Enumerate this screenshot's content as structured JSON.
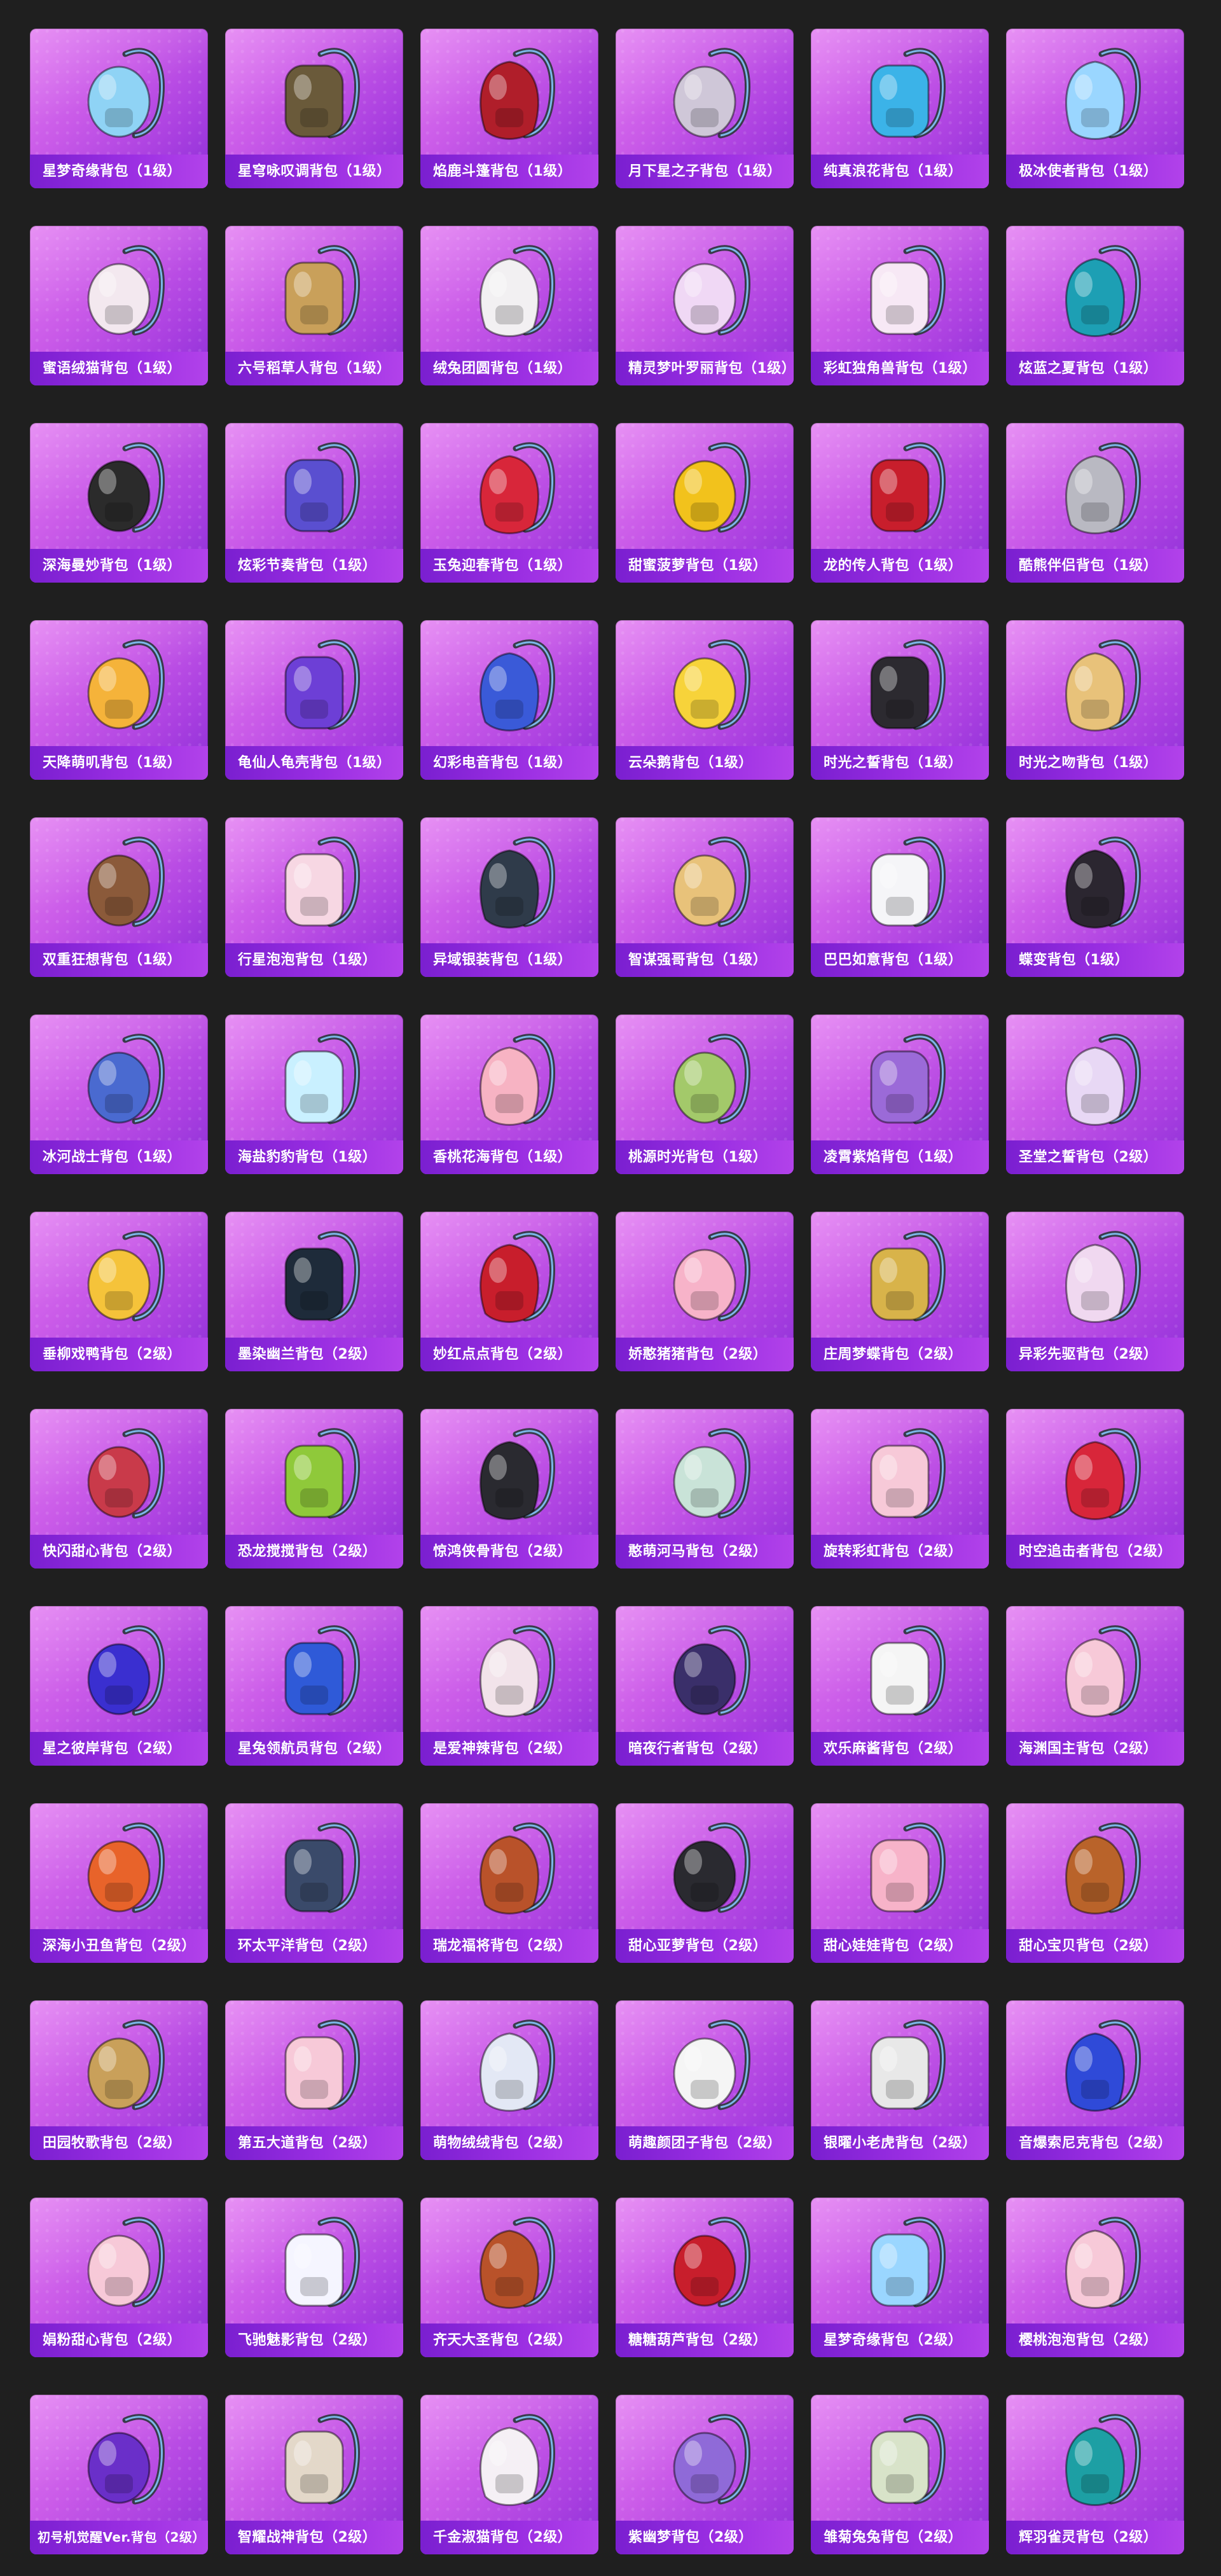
{
  "items": [
    {
      "name": "星梦奇缘背包（1级）",
      "icon": "swan-backpack-icon",
      "color": "#8fd3f5"
    },
    {
      "name": "星穹咏叹调背包（1级）",
      "icon": "bear-backpack-icon",
      "color": "#6a5a3a"
    },
    {
      "name": "焰鹿斗篷背包（1级）",
      "icon": "cloak-backpack-icon",
      "color": "#b01e2a"
    },
    {
      "name": "月下星之子背包（1级）",
      "icon": "orb-backpack-icon",
      "color": "#cfc7d8"
    },
    {
      "name": "纯真浪花背包（1级）",
      "icon": "wave-backpack-icon",
      "color": "#3bb3e8"
    },
    {
      "name": "极冰使者背包（1级）",
      "icon": "ice-backpack-icon",
      "color": "#9ad6ff"
    },
    {
      "name": "蜜语绒猫背包（1级）",
      "icon": "cat-backpack-icon",
      "color": "#f3e8ef"
    },
    {
      "name": "六号稻草人背包（1级）",
      "icon": "scarecrow-backpack-icon",
      "color": "#c9a05a"
    },
    {
      "name": "绒兔团圆背包（1级）",
      "icon": "bunny-backpack-icon",
      "color": "#f2f0f2"
    },
    {
      "name": "精灵梦叶罗丽背包（1级）",
      "icon": "heart-backpack-icon",
      "color": "#f0d8f5"
    },
    {
      "name": "彩虹独角兽背包（1级）",
      "icon": "unicorn-backpack-icon",
      "color": "#f7e8f5"
    },
    {
      "name": "炫蓝之夏背包（1级）",
      "icon": "summer-backpack-icon",
      "color": "#1d9fb4"
    },
    {
      "name": "深海曼妙背包（1级）",
      "icon": "canister-backpack-icon",
      "color": "#2b2b2b"
    },
    {
      "name": "炫彩节奏背包（1级）",
      "icon": "galaxy-backpack-icon",
      "color": "#5a4fd0"
    },
    {
      "name": "玉兔迎春背包（1级）",
      "icon": "red-backpack-icon",
      "color": "#d8263a"
    },
    {
      "name": "甜蜜菠萝背包（1级）",
      "icon": "pineapple-backpack-icon",
      "color": "#f2c21c"
    },
    {
      "name": "龙的传人背包（1级）",
      "icon": "dragon-backpack-icon",
      "color": "#c81e2c"
    },
    {
      "name": "酷熊伴侣背包（1级）",
      "icon": "koala-backpack-icon",
      "color": "#b9b9c2"
    },
    {
      "name": "天降萌叽背包（1级）",
      "icon": "chick-backpack-icon",
      "color": "#f5b33a"
    },
    {
      "name": "龟仙人龟壳背包（1级）",
      "icon": "shell-backpack-icon",
      "color": "#6d3fd6"
    },
    {
      "name": "幻彩电音背包（1级）",
      "icon": "ring-backpack-icon",
      "color": "#3a5ad8"
    },
    {
      "name": "云朵鹅背包（1级）",
      "icon": "flower-backpack-icon",
      "color": "#f7d33a"
    },
    {
      "name": "时光之誓背包（1级）",
      "icon": "clock-backpack-icon",
      "color": "#2c2a30"
    },
    {
      "name": "时光之吻背包（1级）",
      "icon": "pendant-backpack-icon",
      "color": "#e8c27a"
    },
    {
      "name": "双重狂想背包（1级）",
      "icon": "fox-backpack-icon",
      "color": "#8b5a3a"
    },
    {
      "name": "行星泡泡背包（1级）",
      "icon": "rabbit-backpack-icon",
      "color": "#f7d7e3"
    },
    {
      "name": "异域银装背包（1级）",
      "icon": "silver-backpack-icon",
      "color": "#2f3b4a"
    },
    {
      "name": "智谋强哥背包（1级）",
      "icon": "bean-backpack-icon",
      "color": "#e8c27a"
    },
    {
      "name": "巴巴如意背包（1级）",
      "icon": "white-bunny-backpack-icon",
      "color": "#f5f5f8"
    },
    {
      "name": "蝶变背包（1级）",
      "icon": "black-backpack-icon",
      "color": "#2b2630"
    },
    {
      "name": "冰河战士背包（1级）",
      "icon": "armor-backpack-icon",
      "color": "#4a6ad0"
    },
    {
      "name": "海盐豹豹背包（1级）",
      "icon": "seal-backpack-icon",
      "color": "#c9f0ff"
    },
    {
      "name": "香桃花海背包（1级）",
      "icon": "peach-backpack-icon",
      "color": "#f7b3c3"
    },
    {
      "name": "桃源时光背包（1级）",
      "icon": "basket-backpack-icon",
      "color": "#a3c96a"
    },
    {
      "name": "凌霄紫焰背包（1级）",
      "icon": "purple-flame-backpack-icon",
      "color": "#9b6ad8"
    },
    {
      "name": "圣堂之誓背包（2级）",
      "icon": "wing-backpack-icon",
      "color": "#e8d8f5"
    },
    {
      "name": "垂柳戏鸭背包（2级）",
      "icon": "duck-backpack-icon",
      "color": "#f5c33a"
    },
    {
      "name": "墨染幽兰背包（2级）",
      "icon": "orchid-backpack-icon",
      "color": "#1e2b3a"
    },
    {
      "name": "妙红点点背包（2级）",
      "icon": "ladybug-backpack-icon",
      "color": "#c81e2c"
    },
    {
      "name": "娇憨猪猪背包（2级）",
      "icon": "piggy-backpack-icon",
      "color": "#f7b3c9"
    },
    {
      "name": "庄周梦蝶背包（2级）",
      "icon": "butterfly-backpack-icon",
      "color": "#d8b34a"
    },
    {
      "name": "异彩先驱背包（2级）",
      "icon": "robot-backpack-icon",
      "color": "#f0d8f0"
    },
    {
      "name": "快闪甜心背包（2级）",
      "icon": "candy-backpack-icon",
      "color": "#c93a4a"
    },
    {
      "name": "恐龙搅搅背包（2级）",
      "icon": "dino-backpack-icon",
      "color": "#8fc93a"
    },
    {
      "name": "惊鸿侠骨背包（2级）",
      "icon": "tactical-backpack-icon",
      "color": "#2a2a30"
    },
    {
      "name": "憨萌河马背包（2级）",
      "icon": "hippo-backpack-icon",
      "color": "#c9e3d8"
    },
    {
      "name": "旋转彩虹背包（2级）",
      "icon": "dress-backpack-icon",
      "color": "#f7c9d8"
    },
    {
      "name": "时空追击者背包（2级）",
      "icon": "mech-backpack-icon",
      "color": "#d8263a"
    },
    {
      "name": "星之彼岸背包（2级）",
      "icon": "planet-backpack-icon",
      "color": "#3a2fd0"
    },
    {
      "name": "星兔领航员背包（2级）",
      "icon": "astronaut-backpack-icon",
      "color": "#2f5ad8"
    },
    {
      "name": "是爱神辣背包（2级）",
      "icon": "plush-bunny-backpack-icon",
      "color": "#f2e3ea"
    },
    {
      "name": "暗夜行者背包（2级）",
      "icon": "night-backpack-icon",
      "color": "#3a2f6a"
    },
    {
      "name": "欢乐麻酱背包（2级）",
      "icon": "mahjong-backpack-icon",
      "color": "#f5f5f5"
    },
    {
      "name": "海渊国主背包（2级）",
      "icon": "ribbon-backpack-icon",
      "color": "#f7c9d8"
    },
    {
      "name": "深海小丑鱼背包（2级）",
      "icon": "clownfish-backpack-icon",
      "color": "#e8632a"
    },
    {
      "name": "环太平洋背包（2级）",
      "icon": "jaeger-backpack-icon",
      "color": "#3a4a6a"
    },
    {
      "name": "瑞龙福将背包（2级）",
      "icon": "general-backpack-icon",
      "color": "#b9522a"
    },
    {
      "name": "甜心亚萝背包（2级）",
      "icon": "black-cat-backpack-icon",
      "color": "#2a2a30"
    },
    {
      "name": "甜心娃娃背包（2级）",
      "icon": "doll-backpack-icon",
      "color": "#f7b3c9"
    },
    {
      "name": "甜心宝贝背包（2级）",
      "icon": "cake-backpack-icon",
      "color": "#b9632a"
    },
    {
      "name": "田园牧歌背包（2级）",
      "icon": "flower-basket-backpack-icon",
      "color": "#c9a05a"
    },
    {
      "name": "第五大道背包（2级）",
      "icon": "pink-bag-backpack-icon",
      "color": "#f7c9d8"
    },
    {
      "name": "萌物绒绒背包（2级）",
      "icon": "fluffy-backpack-icon",
      "color": "#e3e8f5"
    },
    {
      "name": "萌趣颜团子背包（2级）",
      "icon": "dumpling-backpack-icon",
      "color": "#f5f5f5"
    },
    {
      "name": "银曜小老虎背包（2级）",
      "icon": "tiger-backpack-icon",
      "color": "#e8e8e8"
    },
    {
      "name": "音爆索尼克背包（2级）",
      "icon": "sonic-backpack-icon",
      "color": "#2f4ad8"
    },
    {
      "name": "娟粉甜心背包（2级）",
      "icon": "pink-sweet-backpack-icon",
      "color": "#f7c9d8"
    },
    {
      "name": "飞驰魅影背包（2级）",
      "icon": "cape-backpack-icon",
      "color": "#f5f5ff"
    },
    {
      "name": "齐天大圣背包（2级）",
      "icon": "monkey-king-backpack-icon",
      "color": "#b9522a"
    },
    {
      "name": "糖糖葫芦背包（2级）",
      "icon": "gourd-backpack-icon",
      "color": "#c81e2c"
    },
    {
      "name": "星梦奇缘背包（2级）",
      "icon": "swan-backpack-icon",
      "color": "#9ad6ff"
    },
    {
      "name": "樱桃泡泡背包（2级）",
      "icon": "bow-backpack-icon",
      "color": "#f7c9d8"
    },
    {
      "name": "初号机觉醒Ver.背包（2级）",
      "icon": "eva-backpack-icon",
      "color": "#6a2fc9"
    },
    {
      "name": "智耀战神背包（2级）",
      "icon": "war-god-backpack-icon",
      "color": "#e3d8c9"
    },
    {
      "name": "千金淑猫背包（2级）",
      "icon": "lady-cat-backpack-icon",
      "color": "#f5f0f5"
    },
    {
      "name": "紫幽梦背包（2级）",
      "icon": "violet-backpack-icon",
      "color": "#8f6ad8"
    },
    {
      "name": "雏菊兔兔背包（2级）",
      "icon": "daisy-bunny-backpack-icon",
      "color": "#d8e3c9"
    },
    {
      "name": "辉羽雀灵背包（2级）",
      "icon": "peacock-backpack-icon",
      "color": "#1d9fa4"
    }
  ]
}
